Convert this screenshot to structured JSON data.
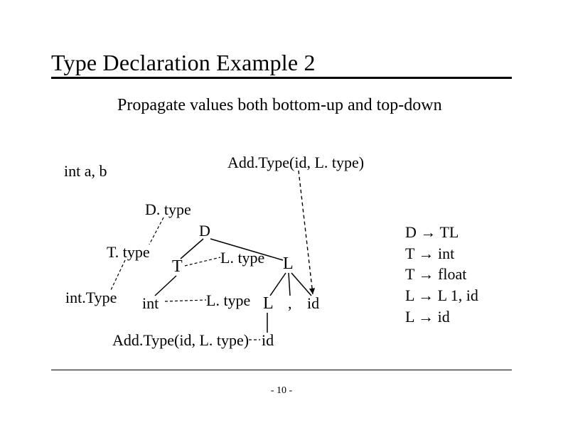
{
  "title": "Type Declaration Example 2",
  "subtitle": "Propagate values both bottom-up and top-down",
  "code": "int a, b",
  "annotation_top": "Add.Type(id, L. type)",
  "labels": {
    "Dtype": "D. type",
    "D": "D",
    "Ttype": "T. type",
    "T": "T",
    "Ltype1": "L. type",
    "L1": "L",
    "intType": "int.Type",
    "int_kw": "int",
    "Ltype2": "L. type",
    "L2": "L",
    "comma": ",",
    "id1": "id",
    "id2": "id"
  },
  "annotation_bottom": "Add.Type(id, L. type)",
  "grammar": {
    "r1_lhs": "D ",
    "r1_rhs": " TL",
    "r2_lhs": "T ",
    "r2_rhs": " int",
    "r3_lhs": "T ",
    "r3_rhs": " float",
    "r4_lhs": "L ",
    "r4_rhs": " L 1, id",
    "r5_lhs": "L ",
    "r5_rhs": " id"
  },
  "arrow": "→",
  "page": "- 10 -"
}
